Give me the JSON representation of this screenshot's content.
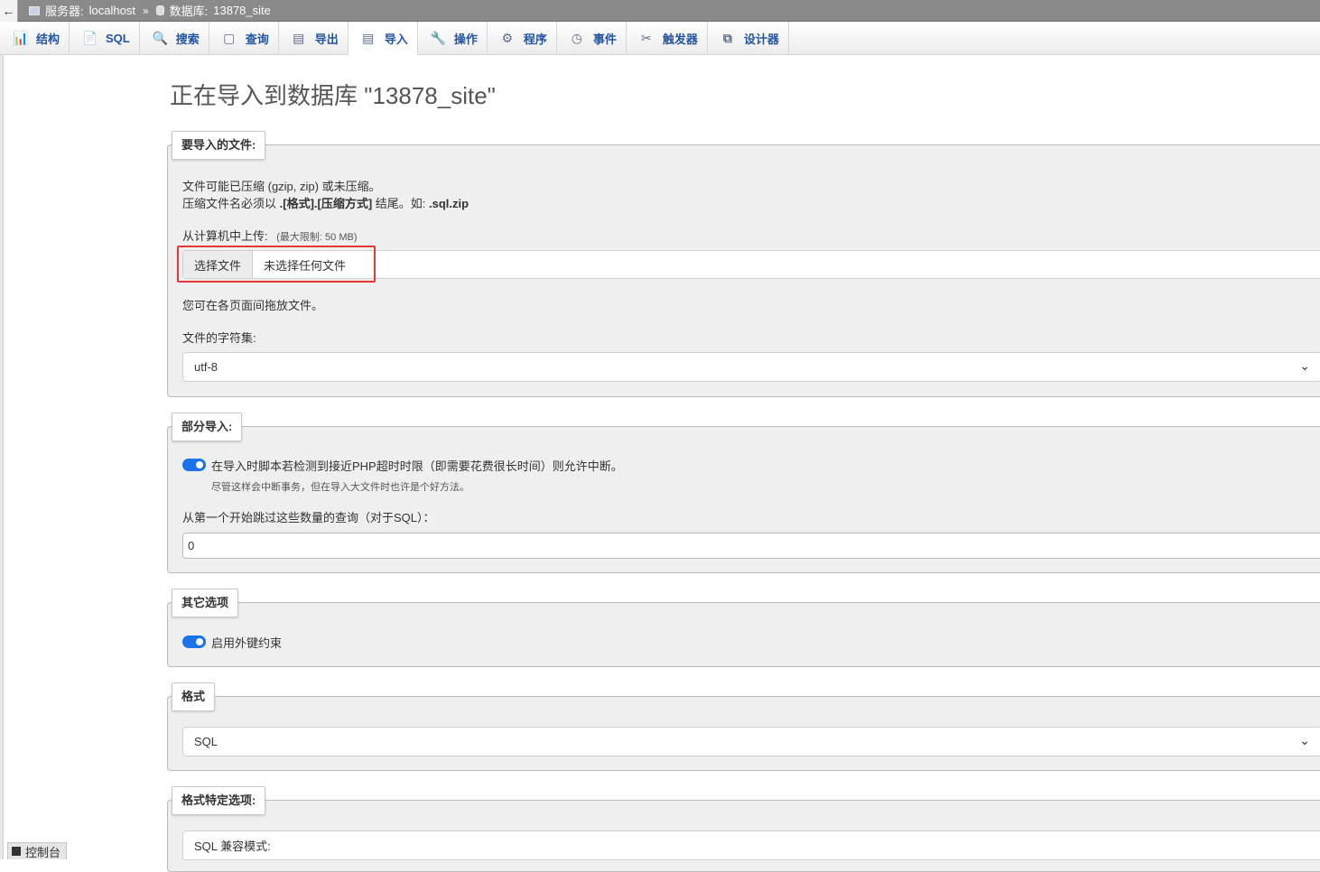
{
  "breadcrumb": {
    "back_icon": "←",
    "server_label": "服务器:",
    "server_value": "localhost",
    "separator": "»",
    "db_label": "数据库:",
    "db_value": "13878_site"
  },
  "tabs": [
    {
      "label": "结构",
      "icon": "📊"
    },
    {
      "label": "SQL",
      "icon": "📄"
    },
    {
      "label": "搜索",
      "icon": "🔍"
    },
    {
      "label": "查询",
      "icon": "▢"
    },
    {
      "label": "导出",
      "icon": "▤"
    },
    {
      "label": "导入",
      "icon": "▤"
    },
    {
      "label": "操作",
      "icon": "🔧"
    },
    {
      "label": "程序",
      "icon": "⚙"
    },
    {
      "label": "事件",
      "icon": "◷"
    },
    {
      "label": "触发器",
      "icon": "✂"
    },
    {
      "label": "设计器",
      "icon": "⧉"
    }
  ],
  "active_tab": "导入",
  "page_title": "正在导入到数据库 \"13878_site\"",
  "file_section": {
    "legend": "要导入的文件:",
    "line1": "文件可能已压缩 (gzip, zip) 或未压缩。",
    "line2_prefix": "压缩文件名必须以 ",
    "line2_bold": ".[格式].[压缩方式]",
    "line2_mid": " 结尾。如: ",
    "line2_example": ".sql.zip",
    "upload_label": "从计算机中上传:",
    "upload_limit": "(最大限制: 50 MB)",
    "choose_button": "选择文件",
    "no_file": "未选择任何文件",
    "drag_hint": "您可在各页面间拖放文件。",
    "charset_label": "文件的字符集:",
    "charset_value": "utf-8"
  },
  "partial_section": {
    "legend": "部分导入:",
    "allow_interrupt": "在导入时脚本若检测到接近PHP超时时限（即需要花费很长时间）则允许中断。",
    "allow_interrupt_note": "尽管这样会中断事务，但在导入大文件时也许是个好方法。",
    "skip_label": "从第一个开始跳过这些数量的查询（对于SQL）：",
    "skip_value": "0"
  },
  "other_section": {
    "legend": "其它选项",
    "fk_label": "启用外键约束"
  },
  "format_section": {
    "legend": "格式",
    "value": "SQL"
  },
  "format_specific": {
    "legend": "格式特定选项:",
    "sql_compat_label": "SQL 兼容模式:"
  },
  "console_label": "控制台",
  "colors": {
    "accent": "#1a73e8",
    "tab_text": "#2355a5",
    "highlight": "#e53935"
  }
}
